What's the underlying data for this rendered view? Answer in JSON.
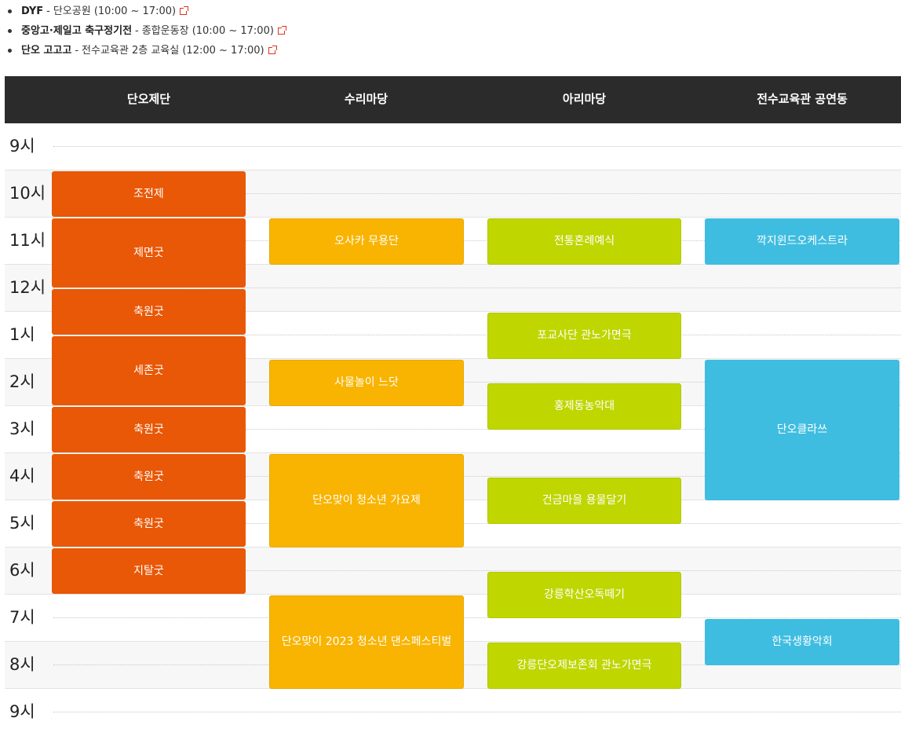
{
  "notices": [
    {
      "name": "DYF",
      "separator": "-",
      "place": "단오공원",
      "time": "(10:00 ~ 17:00)"
    },
    {
      "name": "중앙고·제일고 축구정기전",
      "separator": "-",
      "place": "종합운동장",
      "time": "(10:00 ~ 17:00)"
    },
    {
      "name": "단오 고고고",
      "separator": "-",
      "place": "전수교육관 2층 교육실",
      "time": "(12:00 ~ 17:00)"
    }
  ],
  "columns": [
    "단오제단",
    "수리마당",
    "아리마당",
    "전수교육관 공연동"
  ],
  "hours": [
    "9시",
    "10시",
    "11시",
    "12시",
    "1시",
    "2시",
    "3시",
    "4시",
    "5시",
    "6시",
    "7시",
    "8시",
    "9시"
  ],
  "events": {
    "danoje": [
      "조전제",
      "제면굿",
      "축원굿",
      "세존굿",
      "축원굿",
      "축원굿",
      "축원굿",
      "지탈굿"
    ],
    "suri": [
      "오사카 무용단",
      "사물놀이 느닷",
      "단오맞이 청소년 가요제",
      "단오맞이 2023 청소년 댄스페스티벌"
    ],
    "ari": [
      "전통혼례예식",
      "포교사단 관노가면극",
      "홍제동농악대",
      "건금마을 용물달기",
      "강릉학산오독떼기",
      "강릉단오제보존회 관노가면극"
    ],
    "hall": [
      "깍지윈드오케스트라",
      "단오클라쓰",
      "한국생황악회"
    ]
  },
  "colors": {
    "danoje": "#e85807",
    "suri": "#f8b400",
    "ari": "#bfd600",
    "hall": "#3fbde0",
    "header": "#2b2b2b"
  }
}
